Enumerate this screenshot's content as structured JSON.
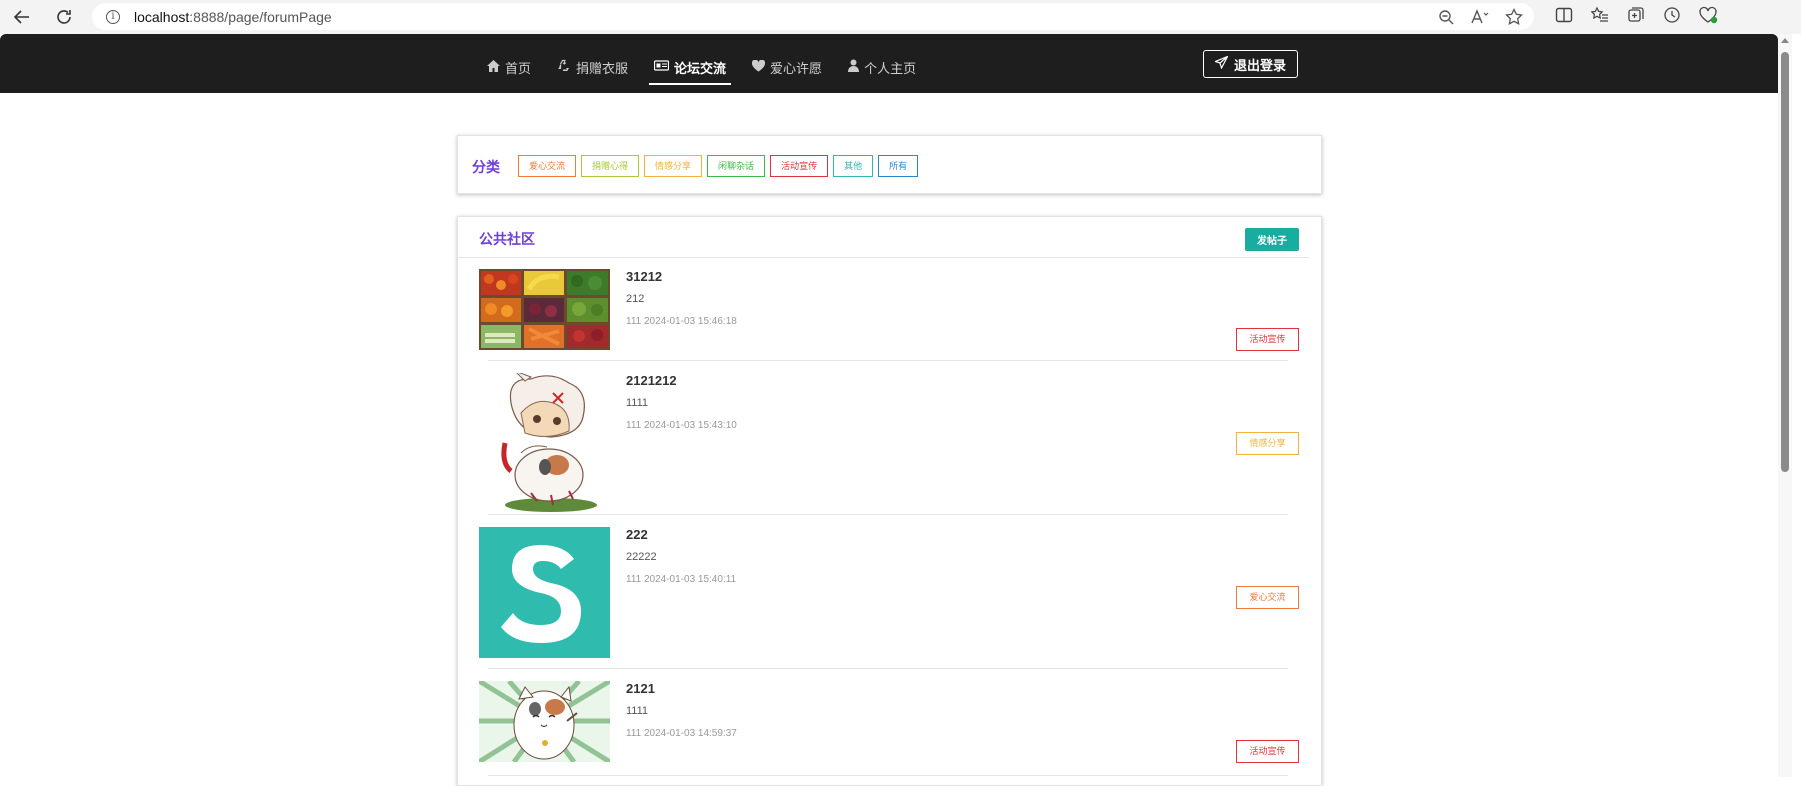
{
  "browser": {
    "url_host": "localhost",
    "url_rest": ":8888/page/forumPage"
  },
  "nav": {
    "items": [
      {
        "icon": "home-icon",
        "label": "首页",
        "active": false
      },
      {
        "icon": "recycle-icon",
        "label": "捐赠衣服",
        "active": false
      },
      {
        "icon": "forum-icon",
        "label": "论坛交流",
        "active": true
      },
      {
        "icon": "heart-icon",
        "label": "爱心许愿",
        "active": false
      },
      {
        "icon": "user-icon",
        "label": "个人主页",
        "active": false
      }
    ],
    "logout_label": "退出登录"
  },
  "categories": {
    "title": "分类",
    "items": [
      {
        "label": "爱心交流",
        "color": "#f07a3a"
      },
      {
        "label": "捐赠心得",
        "color": "#a7c93a"
      },
      {
        "label": "情感分享",
        "color": "#f2b33d"
      },
      {
        "label": "闲聊杂话",
        "color": "#3db84a"
      },
      {
        "label": "活动宣传",
        "color": "#e0343a"
      },
      {
        "label": "其他",
        "color": "#2fb7b0"
      },
      {
        "label": "所有",
        "color": "#2a86c8"
      }
    ]
  },
  "community": {
    "title": "公共社区",
    "post_button": "发帖子",
    "posts": [
      {
        "title": "31212",
        "body": "212",
        "meta": "111 2024-01-03 15:46:18",
        "tag": "活动宣传",
        "tag_color": "#e0343a",
        "image": "vegetables-photo"
      },
      {
        "title": "2121212",
        "body": "1111",
        "meta": "111 2024-01-03 15:43:10",
        "tag": "情感分享",
        "tag_color": "#f2b33d",
        "image": "anime-cat-boy-illustration"
      },
      {
        "title": "222",
        "body": "22222",
        "meta": "111 2024-01-03 15:40:11",
        "tag": "爱心交流",
        "tag_color": "#f07a3a",
        "image": "s-logo"
      },
      {
        "title": "2121",
        "body": "1111",
        "meta": "111 2024-01-03 14:59:37",
        "tag": "活动宣传",
        "tag_color": "#e0343a",
        "image": "anime-cat-illustration"
      }
    ]
  },
  "colors": {
    "nav_bg": "#1e1e1e",
    "accent_purple": "#6e3fd6",
    "teal": "#1aaca0",
    "s_logo_bg": "#2fbcae"
  }
}
